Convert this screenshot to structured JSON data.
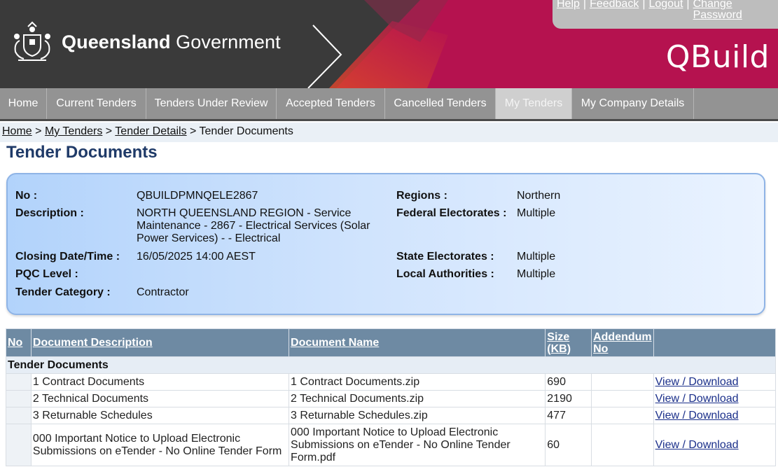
{
  "header": {
    "brand_bold": "Queensland",
    "brand_rest": "Government",
    "app_name": "QBuild",
    "top_links": [
      "Help",
      "Feedback",
      "Logout",
      "Change Password"
    ]
  },
  "nav": {
    "items": [
      "Home",
      "Current Tenders",
      "Tenders Under Review",
      "Accepted Tenders",
      "Cancelled Tenders",
      "My Tenders",
      "My Company Details"
    ],
    "active": "My Tenders"
  },
  "breadcrumb": {
    "links": [
      "Home",
      "My Tenders",
      "Tender Details"
    ],
    "current": "Tender Documents",
    "separator": ">"
  },
  "page_title": "Tender Documents",
  "tender": {
    "no_label": "No :",
    "no_value": "QBUILDPMNQELE2867",
    "description_label": "Description :",
    "description_value": "NORTH QUEENSLAND REGION - Service Maintenance - 2867 - Electrical Services (Solar Power Services) - - Electrical",
    "closing_label": "Closing Date/Time :",
    "closing_value": "16/05/2025 14:00 AEST",
    "pqc_label": "PQC Level :",
    "pqc_value": "",
    "category_label": "Tender Category :",
    "category_value": "Contractor",
    "regions_label": "Regions :",
    "regions_value": "Northern",
    "federal_label": "Federal Electorates :",
    "federal_value": "Multiple",
    "state_label": "State Electorates :",
    "state_value": "Multiple",
    "local_label": "Local Authorities :",
    "local_value": "Multiple"
  },
  "table": {
    "headers": {
      "no": "No",
      "description": "Document Description",
      "name": "Document Name",
      "size": "Size (KB)",
      "addendum": "Addendum No"
    },
    "group_label": "Tender Documents",
    "link_label": "View / Download",
    "rows": [
      {
        "description": "1 Contract Documents",
        "name": "1 Contract Documents.zip",
        "size": "690",
        "addendum": ""
      },
      {
        "description": "2 Technical Documents",
        "name": "2 Technical Documents.zip",
        "size": "2190",
        "addendum": ""
      },
      {
        "description": "3 Returnable Schedules",
        "name": "3 Returnable Schedules.zip",
        "size": "477",
        "addendum": ""
      },
      {
        "description": "000 Important Notice to Upload Electronic Submissions on eTender - No Online Tender Form",
        "name": "000 Important Notice to Upload Electronic Submissions on eTender - No Online Tender Form.pdf",
        "size": "60",
        "addendum": ""
      }
    ]
  },
  "colors": {
    "brand_maroon": "#b5124f",
    "header_dark": "#3a3a3a",
    "nav_grey": "#939393",
    "table_header": "#6e8aa3",
    "title_blue": "#1f3a68"
  }
}
